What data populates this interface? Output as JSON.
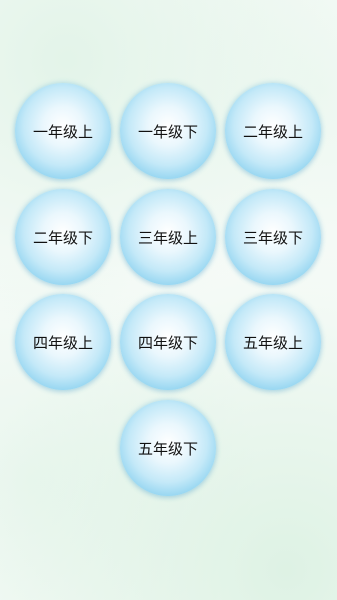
{
  "grades": [
    {
      "label": "一年级上"
    },
    {
      "label": "一年级下"
    },
    {
      "label": "二年级上"
    },
    {
      "label": "二年级下"
    },
    {
      "label": "三年级上"
    },
    {
      "label": "三年级下"
    },
    {
      "label": "四年级上"
    },
    {
      "label": "四年级下"
    },
    {
      "label": "五年级上"
    },
    {
      "label": "五年级下"
    }
  ],
  "colors": {
    "button_edge": "#4ab6e3",
    "button_center": "#ffffff",
    "background": "#f7fbf8",
    "label_text": "#111111"
  }
}
